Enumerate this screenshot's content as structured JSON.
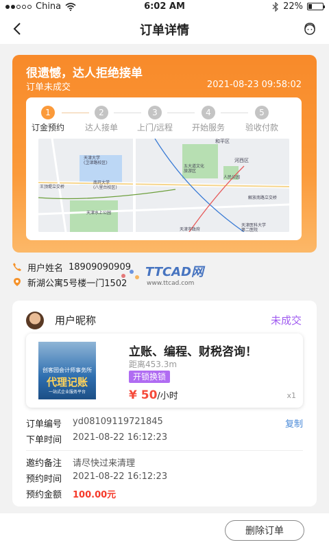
{
  "statusbar": {
    "carrier": "China",
    "time": "6:02 AM",
    "battery": "22%",
    "battery_level": 0.22
  },
  "nav": {
    "title": "订单详情",
    "back_icon": "back-arrow-icon",
    "service_icon": "customer-service-icon"
  },
  "order": {
    "headline": "很遗憾，达人拒绝接单",
    "status": "订单未成交",
    "datetime": "2021-08-23  09:58:02",
    "steps": [
      {
        "num": "1",
        "label": "订金预约"
      },
      {
        "num": "2",
        "label": "达人接单"
      },
      {
        "num": "3",
        "label": "上门/远程"
      },
      {
        "num": "4",
        "label": "开始服务"
      },
      {
        "num": "5",
        "label": "验收付款"
      }
    ],
    "active_step": 1,
    "map_labels": {
      "a": "天津大学\n(卫津路校区)",
      "b": "南开大学\n(八里台校区)",
      "c": "五大道文化\n旅游区",
      "d": "河西区",
      "e": "和平区",
      "f": "王顶堤立交桥",
      "g": "天津水上公园",
      "h": "人民公园",
      "i": "解放南路立交桥",
      "j": "天津医科大学\n第二医院",
      "k": "天津市政府"
    }
  },
  "contact": {
    "name_label": "用户姓名",
    "name_value": "18909090909",
    "address": "新湖公寓5号楼一门1502"
  },
  "watermark": {
    "brand": "TTCAD网",
    "url": "www.ttcad.com"
  },
  "detail": {
    "nickname": "用户昵称",
    "status": "未成交",
    "product": {
      "name": "立账、编程、财税咨询！",
      "distance": "距离453.3m",
      "tag": "开锁换锁",
      "price": "¥ 50",
      "unit": "/小时",
      "qty": "x1",
      "thumb_line1": "创客园会计师事务所",
      "thumb_line2": "代理记账",
      "thumb_line3": "一站式企业服务平台"
    },
    "order_no_label": "订单编号",
    "order_no": "yd08109119721845",
    "copy_label": "复制",
    "order_time_label": "下单时间",
    "order_time": "2021-08-22  16:12:23",
    "remark_label": "邀约备注",
    "remark": "请尽快过来清理",
    "appoint_time_label": "预约时间",
    "appoint_time": "2021-08-22  16:12:23",
    "amount_label": "预约金额",
    "amount": "100.00元"
  },
  "bottom": {
    "delete_label": "删除订单"
  },
  "colors": {
    "orange": "#fb9a3a",
    "purple": "#a05cf0",
    "red": "#f54a3a",
    "link": "#4a8ad8"
  }
}
